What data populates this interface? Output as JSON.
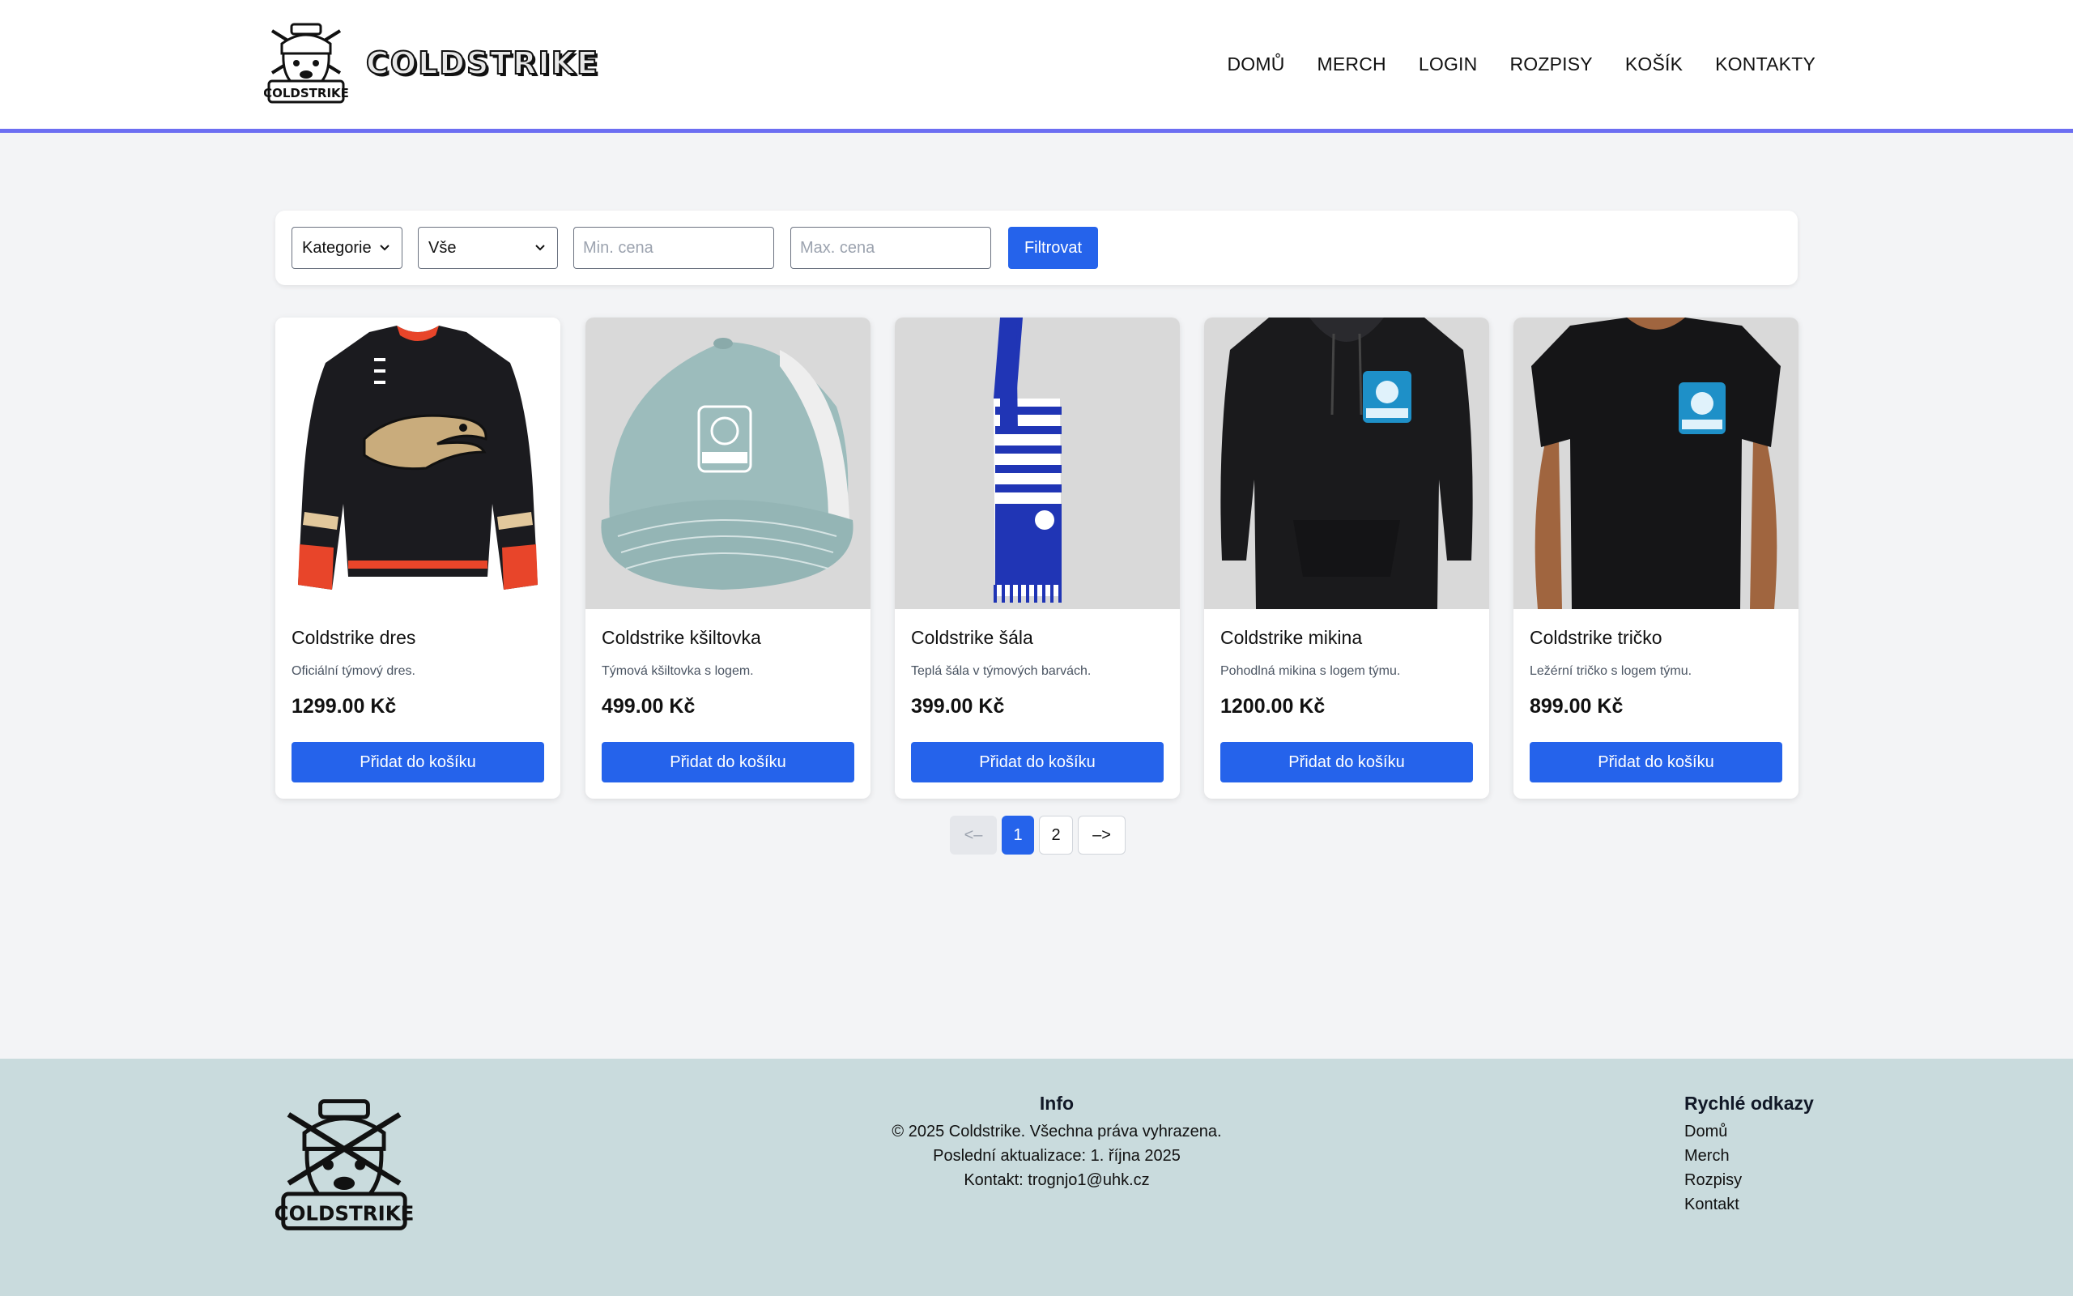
{
  "brand": {
    "name": "COLDSTRIKE",
    "logo_text": "COLDSTRIKE"
  },
  "nav": {
    "home": "DOMŮ",
    "merch": "MERCH",
    "login": "LOGIN",
    "schedule": "ROZPISY",
    "cart": "KOŠÍK",
    "contacts": "KONTAKTY"
  },
  "filters": {
    "category_select": "Kategorie",
    "value_select": "Vše",
    "min_price_placeholder": "Min. cena",
    "max_price_placeholder": "Max. cena",
    "filter_button": "Filtrovat"
  },
  "products": [
    {
      "title": "Coldstrike dres",
      "description": "Oficiální týmový dres.",
      "price": "1299.00 Kč",
      "button": "Přidat do košíku",
      "image": "jersey"
    },
    {
      "title": "Coldstrike kšiltovka",
      "description": "Týmová kšiltovka s logem.",
      "price": "499.00 Kč",
      "button": "Přidat do košíku",
      "image": "cap"
    },
    {
      "title": "Coldstrike šála",
      "description": "Teplá šála v týmových barvách.",
      "price": "399.00 Kč",
      "button": "Přidat do košíku",
      "image": "scarf"
    },
    {
      "title": "Coldstrike mikina",
      "description": "Pohodlná mikina s logem týmu.",
      "price": "1200.00 Kč",
      "button": "Přidat do košíku",
      "image": "hoodie"
    },
    {
      "title": "Coldstrike tričko",
      "description": "Ležérní tričko s logem týmu.",
      "price": "899.00 Kč",
      "button": "Přidat do košíku",
      "image": "tshirt"
    }
  ],
  "pagination": {
    "prev": "<–",
    "pages": [
      "1",
      "2"
    ],
    "current": "1",
    "next": "–>"
  },
  "footer": {
    "info_title": "Info",
    "copyright": "© 2025 Coldstrike. Všechna práva vyhrazena.",
    "updated": "Poslední aktualizace: 1. října 2025",
    "contact": "Kontakt: trognjo1@uhk.cz",
    "links_title": "Rychlé odkazy",
    "links": [
      "Domů",
      "Merch",
      "Rozpisy",
      "Kontakt"
    ]
  },
  "colors": {
    "accent": "#2563eb",
    "header_border": "#6c6ef2",
    "footer_bg": "#c9dbdd",
    "page_bg": "#f3f4f6"
  }
}
